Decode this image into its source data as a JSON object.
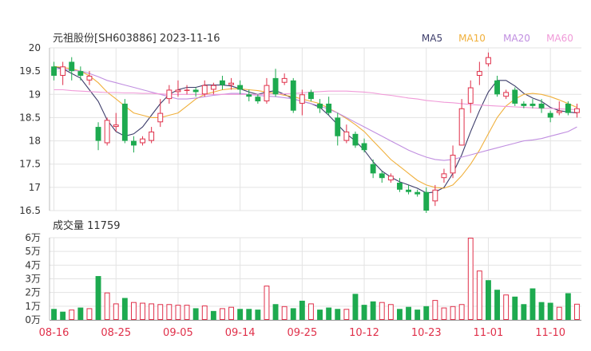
{
  "header": {
    "title": "元祖股份[SH603886] 2023-11-16"
  },
  "legend": [
    {
      "name": "MA5",
      "color": "#3d3d6b"
    },
    {
      "name": "MA10",
      "color": "#f0b03c"
    },
    {
      "name": "MA20",
      "color": "#c08ee0"
    },
    {
      "name": "MA60",
      "color": "#f09ad8"
    }
  ],
  "colors": {
    "up": "#e0304a",
    "down": "#1daa4f",
    "grid": "#e3e3e3",
    "axis": "#333333",
    "xtick": "#e0304a"
  },
  "volume_label": "成交量 11759",
  "chart_data": [
    {
      "type": "candlestick",
      "title": "元祖股份[SH603886] 2023-11-16",
      "xlabel": "",
      "ylabel": "",
      "ylim": [
        16.5,
        20
      ],
      "y_ticks": [
        "20",
        "19.5",
        "19",
        "18.5",
        "18",
        "17.5",
        "17",
        "16.5"
      ],
      "x_ticks": [
        {
          "label": "08-16",
          "index": 0
        },
        {
          "label": "08-25",
          "index": 7
        },
        {
          "label": "09-05",
          "index": 14
        },
        {
          "label": "09-14",
          "index": 21
        },
        {
          "label": "09-25",
          "index": 28
        },
        {
          "label": "10-12",
          "index": 35
        },
        {
          "label": "10-23",
          "index": 42
        },
        {
          "label": "11-01",
          "index": 49
        },
        {
          "label": "11-10",
          "index": 56
        }
      ],
      "grid": true,
      "legend_position": "top-right",
      "candles": [
        [
          19.6,
          19.4,
          19.7,
          19.3
        ],
        [
          19.4,
          19.6,
          19.7,
          19.2
        ],
        [
          19.7,
          19.5,
          19.8,
          19.3
        ],
        [
          19.5,
          19.4,
          19.6,
          19.3
        ],
        [
          19.3,
          19.4,
          19.5,
          19.2
        ],
        [
          18.3,
          18.0,
          18.4,
          17.8
        ],
        [
          17.95,
          18.45,
          18.5,
          17.9
        ],
        [
          18.3,
          18.35,
          18.6,
          18.2
        ],
        [
          18.8,
          18.0,
          18.9,
          17.95
        ],
        [
          18.0,
          17.9,
          18.1,
          17.75
        ],
        [
          17.95,
          18.05,
          18.1,
          17.9
        ],
        [
          18.0,
          18.2,
          18.3,
          17.95
        ],
        [
          18.4,
          18.6,
          18.9,
          18.3
        ],
        [
          18.9,
          19.1,
          19.2,
          18.8
        ],
        [
          19.05,
          19.1,
          19.3,
          18.95
        ],
        [
          19.1,
          19.1,
          19.2,
          19.0
        ],
        [
          19.1,
          19.05,
          19.15,
          18.95
        ],
        [
          19.0,
          19.2,
          19.3,
          18.95
        ],
        [
          19.1,
          19.2,
          19.25,
          19.0
        ],
        [
          19.3,
          19.2,
          19.4,
          19.1
        ],
        [
          19.2,
          19.25,
          19.35,
          19.1
        ],
        [
          19.2,
          19.1,
          19.3,
          19.0
        ],
        [
          19.0,
          18.95,
          19.1,
          18.85
        ],
        [
          18.95,
          18.85,
          19.0,
          18.8
        ],
        [
          18.85,
          19.2,
          19.35,
          18.8
        ],
        [
          19.35,
          19.0,
          19.55,
          18.95
        ],
        [
          19.25,
          19.35,
          19.45,
          19.2
        ],
        [
          19.3,
          18.65,
          19.35,
          18.6
        ],
        [
          18.8,
          19.0,
          19.1,
          18.55
        ],
        [
          19.05,
          18.9,
          19.1,
          18.85
        ],
        [
          18.8,
          18.7,
          18.9,
          18.6
        ],
        [
          18.8,
          18.6,
          18.95,
          18.55
        ],
        [
          18.5,
          18.1,
          18.6,
          17.9
        ],
        [
          18.0,
          18.2,
          18.35,
          17.95
        ],
        [
          18.15,
          17.9,
          18.2,
          17.85
        ],
        [
          17.95,
          17.8,
          18.05,
          17.75
        ],
        [
          17.5,
          17.3,
          17.6,
          17.2
        ],
        [
          17.3,
          17.2,
          17.35,
          17.1
        ],
        [
          17.15,
          17.25,
          17.3,
          17.1
        ],
        [
          17.1,
          16.95,
          17.2,
          16.9
        ],
        [
          16.95,
          16.9,
          17.05,
          16.85
        ],
        [
          16.9,
          16.85,
          16.95,
          16.8
        ],
        [
          16.9,
          16.5,
          17.0,
          16.45
        ],
        [
          16.7,
          16.95,
          17.05,
          16.6
        ],
        [
          17.2,
          17.3,
          17.4,
          17.1
        ],
        [
          17.3,
          17.7,
          17.9,
          17.2
        ],
        [
          17.9,
          18.7,
          18.9,
          17.9
        ],
        [
          18.8,
          19.15,
          19.3,
          18.6
        ],
        [
          19.4,
          19.5,
          19.7,
          19.2
        ],
        [
          19.65,
          19.8,
          19.9,
          19.6
        ],
        [
          19.3,
          19.0,
          19.4,
          18.95
        ],
        [
          18.95,
          19.05,
          19.1,
          18.9
        ],
        [
          19.1,
          18.8,
          19.15,
          18.75
        ],
        [
          18.8,
          18.75,
          18.85,
          18.7
        ],
        [
          18.8,
          18.75,
          18.9,
          18.7
        ],
        [
          18.8,
          18.7,
          18.9,
          18.6
        ],
        [
          18.6,
          18.5,
          18.65,
          18.4
        ],
        [
          18.6,
          18.65,
          18.85,
          18.55
        ],
        [
          18.8,
          18.6,
          18.85,
          18.55
        ],
        [
          18.6,
          18.7,
          18.8,
          18.5
        ]
      ],
      "series": [
        {
          "name": "MA5",
          "values": [
            19.6,
            19.55,
            19.45,
            19.35,
            19.1,
            18.85,
            18.45,
            18.2,
            18.1,
            18.15,
            18.3,
            18.55,
            18.8,
            19.0,
            19.1,
            19.15,
            19.15,
            19.2,
            19.2,
            19.2,
            19.18,
            19.12,
            19.05,
            19.0,
            19.05,
            19.08,
            19.0,
            18.9,
            18.85,
            18.8,
            18.72,
            18.55,
            18.35,
            18.15,
            18.0,
            17.8,
            17.55,
            17.35,
            17.22,
            17.12,
            17.05,
            16.98,
            16.88,
            16.9,
            17.0,
            17.3,
            17.7,
            18.2,
            18.65,
            19.05,
            19.3,
            19.3,
            19.18,
            19.02,
            18.92,
            18.85,
            18.72,
            18.65,
            18.62,
            18.6
          ]
        },
        {
          "name": "MA10",
          "values": [
            19.6,
            19.58,
            19.55,
            19.5,
            19.4,
            19.25,
            19.05,
            18.9,
            18.75,
            18.6,
            18.55,
            18.5,
            18.5,
            18.55,
            18.6,
            18.75,
            18.9,
            19.0,
            19.05,
            19.1,
            19.12,
            19.12,
            19.1,
            19.08,
            19.05,
            19.02,
            18.98,
            18.95,
            18.9,
            18.85,
            18.8,
            18.7,
            18.6,
            18.48,
            18.35,
            18.2,
            18.0,
            17.8,
            17.6,
            17.45,
            17.3,
            17.15,
            17.05,
            17.0,
            16.98,
            17.05,
            17.25,
            17.5,
            17.8,
            18.15,
            18.5,
            18.75,
            18.9,
            19.0,
            19.02,
            19.0,
            18.95,
            18.88,
            18.8,
            18.72
          ]
        },
        {
          "name": "MA20",
          "values": [
            19.55,
            19.55,
            19.52,
            19.5,
            19.45,
            19.38,
            19.3,
            19.25,
            19.2,
            19.15,
            19.1,
            19.05,
            19.0,
            18.95,
            18.9,
            18.9,
            18.92,
            18.95,
            18.98,
            19.0,
            19.02,
            19.02,
            19.0,
            18.98,
            18.96,
            18.95,
            18.93,
            18.9,
            18.85,
            18.8,
            18.75,
            18.68,
            18.6,
            18.5,
            18.4,
            18.3,
            18.2,
            18.1,
            18.0,
            17.9,
            17.8,
            17.72,
            17.65,
            17.6,
            17.58,
            17.6,
            17.65,
            17.7,
            17.75,
            17.8,
            17.85,
            17.9,
            17.95,
            18.0,
            18.02,
            18.05,
            18.1,
            18.15,
            18.2,
            18.3
          ]
        },
        {
          "name": "MA60",
          "values": [
            19.1,
            19.1,
            19.08,
            19.07,
            19.06,
            19.05,
            19.04,
            19.04,
            19.03,
            19.03,
            19.02,
            19.02,
            19.01,
            19.0,
            19.0,
            19.0,
            19.0,
            19.0,
            19.0,
            19.0,
            19.0,
            19.0,
            19.0,
            19.0,
            19.0,
            19.01,
            19.01,
            19.02,
            19.03,
            19.05,
            19.06,
            19.07,
            19.07,
            19.07,
            19.06,
            19.05,
            19.03,
            19.0,
            18.98,
            18.95,
            18.92,
            18.9,
            18.87,
            18.85,
            18.83,
            18.82,
            18.8,
            18.78,
            18.77,
            18.76,
            18.75,
            18.74,
            18.73,
            18.72,
            18.71,
            18.7,
            18.7,
            18.69,
            18.68,
            18.67
          ]
        }
      ]
    },
    {
      "type": "bar",
      "title": "成交量 11759",
      "xlabel": "",
      "ylabel": "",
      "ylim": [
        0,
        60000
      ],
      "y_ticks": [
        "6万",
        "5万",
        "4万",
        "3万",
        "2万",
        "1万",
        "0万"
      ],
      "values": [
        8000,
        6000,
        7500,
        9000,
        8500,
        32000,
        20000,
        12000,
        16000,
        13000,
        12500,
        12000,
        11500,
        11500,
        11000,
        11000,
        8500,
        10500,
        6500,
        8500,
        9500,
        8000,
        8000,
        7500,
        25000,
        11500,
        10000,
        8500,
        14000,
        12000,
        7500,
        9000,
        8000,
        8000,
        19000,
        11000,
        13500,
        13000,
        11500,
        8000,
        9500,
        7500,
        10000,
        14500,
        9000,
        10000,
        11500,
        60000,
        36000,
        29000,
        22000,
        18500,
        17000,
        11500,
        23000,
        13000,
        12500,
        9500,
        19500,
        11759
      ],
      "directions": [
        "down",
        "down",
        "up",
        "down",
        "up",
        "down",
        "up",
        "up",
        "down",
        "up",
        "up",
        "up",
        "up",
        "up",
        "up",
        "up",
        "down",
        "up",
        "down",
        "up",
        "up",
        "down",
        "down",
        "down",
        "up",
        "down",
        "up",
        "down",
        "down",
        "up",
        "down",
        "down",
        "down",
        "up",
        "down",
        "down",
        "down",
        "up",
        "up",
        "down",
        "down",
        "down",
        "down",
        "up",
        "up",
        "up",
        "up",
        "up",
        "up",
        "down",
        "down",
        "up",
        "down",
        "down",
        "down",
        "down",
        "down",
        "up",
        "down",
        "up"
      ]
    }
  ]
}
